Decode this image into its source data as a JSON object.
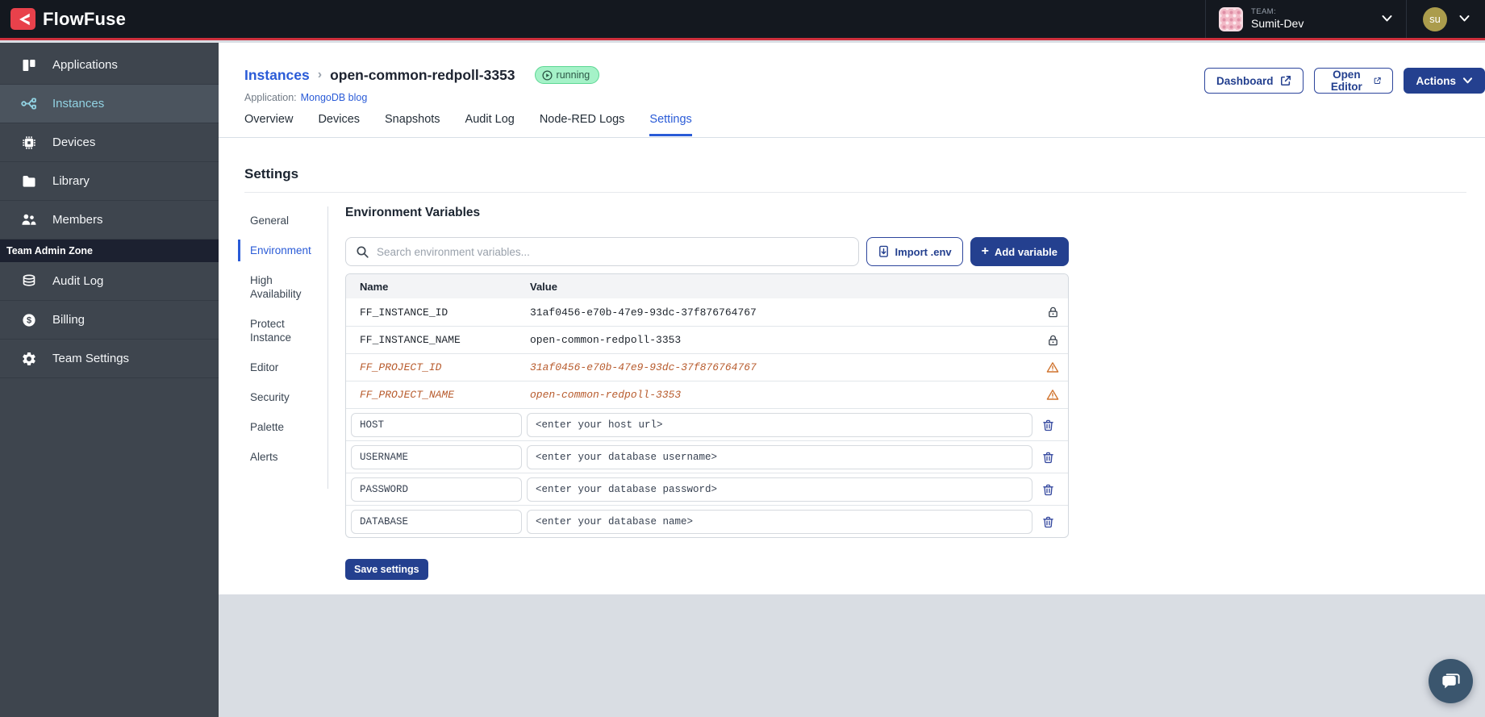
{
  "topbar": {
    "brand": "FlowFuse",
    "team_label": "TEAM:",
    "team_name": "Sumit-Dev",
    "user_initials": "su"
  },
  "sidebar": {
    "items": [
      {
        "label": "Applications"
      },
      {
        "label": "Instances"
      },
      {
        "label": "Devices"
      },
      {
        "label": "Library"
      },
      {
        "label": "Members"
      }
    ],
    "admin_label": "Team Admin Zone",
    "admin_items": [
      {
        "label": "Audit Log"
      },
      {
        "label": "Billing"
      },
      {
        "label": "Team Settings"
      }
    ]
  },
  "header": {
    "breadcrumb_parent": "Instances",
    "breadcrumb_sep": "›",
    "instance_name": "open-common-redpoll-3353",
    "status": "running",
    "app_label": "Application:",
    "app_name": "MongoDB blog",
    "dashboard_label": "Dashboard",
    "open_editor_label": "Open Editor",
    "actions_label": "Actions"
  },
  "tabs": [
    {
      "label": "Overview"
    },
    {
      "label": "Devices"
    },
    {
      "label": "Snapshots"
    },
    {
      "label": "Audit Log"
    },
    {
      "label": "Node-RED Logs"
    },
    {
      "label": "Settings"
    }
  ],
  "settings": {
    "title": "Settings",
    "nav": [
      {
        "label": "General"
      },
      {
        "label": "Environment"
      },
      {
        "label": "High Availability"
      },
      {
        "label": "Protect Instance"
      },
      {
        "label": "Editor"
      },
      {
        "label": "Security"
      },
      {
        "label": "Palette"
      },
      {
        "label": "Alerts"
      }
    ]
  },
  "env": {
    "title": "Environment Variables",
    "search_placeholder": "Search environment variables...",
    "import_label": "Import .env",
    "add_label": "Add variable",
    "columns": {
      "name": "Name",
      "value": "Value"
    },
    "locked_rows": [
      {
        "name": "FF_INSTANCE_ID",
        "value": "31af0456-e70b-47e9-93dc-37f876764767"
      },
      {
        "name": "FF_INSTANCE_NAME",
        "value": "open-common-redpoll-3353"
      },
      {
        "name": "FF_PROJECT_ID",
        "value": "31af0456-e70b-47e9-93dc-37f876764767"
      },
      {
        "name": "FF_PROJECT_NAME",
        "value": "open-common-redpoll-3353"
      }
    ],
    "editable_rows": [
      {
        "name": "HOST",
        "value": "<enter your host url>"
      },
      {
        "name": "USERNAME",
        "value": "<enter your database username>"
      },
      {
        "name": "PASSWORD",
        "value": "<enter your database password>"
      },
      {
        "name": "DATABASE",
        "value": "<enter your database name>"
      }
    ],
    "save_label": "Save settings"
  },
  "colors": {
    "brand_red": "#e8414b",
    "accent_blue": "#2a5bd7",
    "navy_button": "#24408f",
    "status_green_bg": "#a5f2c8",
    "status_green_border": "#5cd793",
    "warning_orange": "#b85c2e",
    "sidebar_bg": "#3e454e"
  }
}
